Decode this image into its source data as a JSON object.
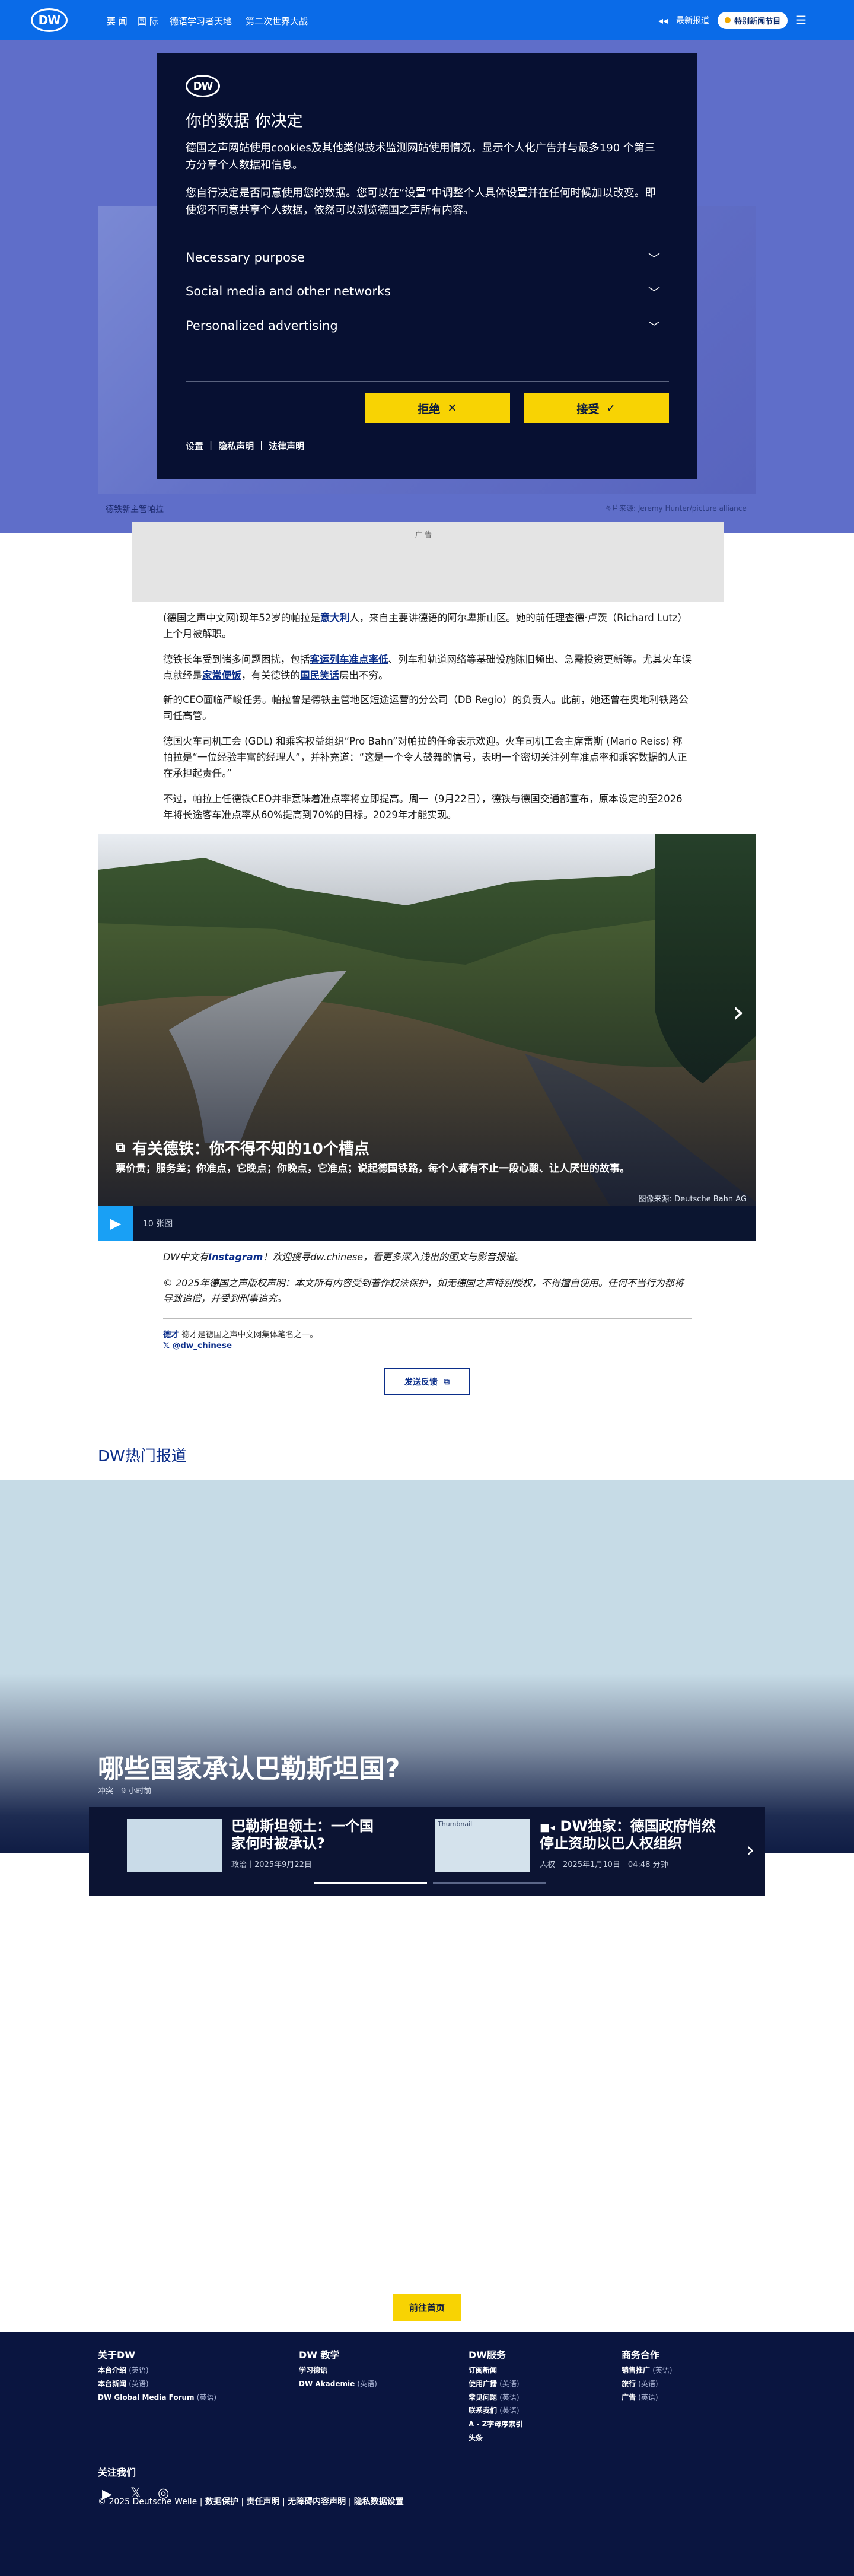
{
  "header": {
    "logo": "DW",
    "nav": [
      "要 闻",
      "国 际",
      "德语学习者天地",
      "第二次世界大战"
    ],
    "live_label": "最新报道",
    "live_pill": "特别新闻节目"
  },
  "hero": {
    "caption_left": "德铁新主管帕拉",
    "caption_right": "图片来源: Jeremy Hunter/picture alliance"
  },
  "ad": {
    "label": "广 告"
  },
  "article": {
    "p1_a": "(德国之声中文网)现年52岁的帕拉是",
    "p1_link": "意大利",
    "p1_b": "人，来自主要讲德语的阿尔卑斯山区。她的前任理查德·卢茨（Richard Lutz）上个月被解职。",
    "p2_a": "德铁长年受到诸多问题困扰，包括",
    "p2_link1": "客运列车准点率低",
    "p2_b": "、列车和轨道网络等基础设施陈旧频出、急需投资更新等。尤其火车误点就经是",
    "p2_link2": "家常便饭",
    "p2_c": "，有关德铁的",
    "p2_link3": "国民笑话",
    "p2_d": "层出不穷。",
    "p3": "新的CEO面临严峻任务。帕拉曾是德铁主管地区短途运营的分公司（DB Regio）的负责人。此前，她还曾在奥地利铁路公司任高管。",
    "p4": "德国火车司机工会 (GDL) 和乘客权益组织“Pro Bahn”对帕拉的任命表示欢迎。火车司机工会主席雷斯 (Mario Reiss) 称帕拉是“一位经验丰富的经理人”，并补充道：“这是一个令人鼓舞的信号，表明一个密切关注列车准点率和乘客数据的人正在承担起责任。”",
    "p5": "不过，帕拉上任德铁CEO并非意味着准点率将立即提高。周一（9月22日），德铁与德国交通部宣布，原本设定的至2026年将长途客车准点率从60%提高到70%的目标。2029年才能实现。"
  },
  "gallery": {
    "title": "有关德铁：你不得不知的10个槽点",
    "subtitle": "票价贵；服务差；你准点，它晚点；你晚点，它准点；说起德国铁路，每个人都有不止一段心酸、让人厌世的故事。",
    "credit": "图像来源: Deutsche Bahn AG",
    "count": "10 张图"
  },
  "footnote": {
    "n1_a": "DW中文有",
    "n1_link": "Instagram",
    "n1_b": "！欢迎搜寻dw.chinese，看更多深入浅出的图文与影音报道。",
    "n2": "© 2025年德国之声版权声明：本文所有内容受到著作权法保护，如无德国之声特别授权，不得擅自使用。任何不当行为都将导致追偿，并受到刑事追究。"
  },
  "author": {
    "name": "德才",
    "text": "德才是德国之声中文网集体笔名之一。",
    "handle": "@dw_chinese"
  },
  "feedback": {
    "label": "发送反馈"
  },
  "hot": {
    "section_title": "DW热门报道",
    "headline": "哪些国家承认巴勒斯坦国?",
    "meta": "冲突｜9 小时前",
    "cards": [
      {
        "title": "巴勒斯坦领土：一个国家何时被承认?",
        "meta": "政治｜2025年9月22日"
      },
      {
        "title": "DW独家：德国政府悄然停止资助以巴人权组织",
        "meta": "人权｜2025年1月10日｜04:48 分钟",
        "img_alt": "Thumbnail"
      }
    ]
  },
  "home_button": {
    "label": "前往首页"
  },
  "footer": {
    "col1": {
      "heading": "关于DW",
      "links": [
        {
          "t": "本台介绍",
          "s": "(英语)"
        },
        {
          "t": "本台新闻",
          "s": "(英语)"
        },
        {
          "t": "DW Global Media Forum",
          "s": "(英语)"
        }
      ]
    },
    "col2": {
      "heading": "DW 教学",
      "links": [
        {
          "t": "学习德语",
          "s": ""
        },
        {
          "t": "DW Akademie",
          "s": "(英语)"
        }
      ]
    },
    "col3": {
      "heading": "DW服务",
      "links": [
        {
          "t": "订阅新闻",
          "s": ""
        },
        {
          "t": "使用广播",
          "s": "(英语)"
        },
        {
          "t": "常见问题",
          "s": "(英语)"
        },
        {
          "t": "联系我们",
          "s": "(英语)"
        },
        {
          "t": "A - Z字母序索引",
          "s": ""
        },
        {
          "t": "头条",
          "s": ""
        }
      ]
    },
    "col4": {
      "heading": "商务合作",
      "links": [
        {
          "t": "销售推广",
          "s": "(英语)"
        },
        {
          "t": "旅行",
          "s": "(英语)"
        },
        {
          "t": "广告",
          "s": "(英语)"
        }
      ]
    },
    "follow_label": "关注我们",
    "copyright": "© 2025 Deutsche Welle",
    "bottom_links": [
      "数据保护",
      "责任声明",
      "无障碍内容声明",
      "隐私数据设置"
    ]
  },
  "cookie": {
    "logo": "DW",
    "title": "你的数据 你决定",
    "p1": "德国之声网站使用cookies及其他类似技术监测网站使用情况，显示个人化广告并与最多190 个第三方分享个人数据和信息。",
    "p2": "您自行决定是否同意使用您的数据。您可以在“设置”中调整个人具体设置并在任何时候加以改变。即使您不同意共享个人数据，依然可以浏览德国之声所有内容。",
    "purposes": [
      "Necessary purpose",
      "Social media and other networks",
      "Personalized advertising"
    ],
    "reject": "拒绝",
    "accept": "接受",
    "links": [
      "设置",
      "隐私声明",
      "法律声明"
    ]
  },
  "colors": {
    "brand_blue": "#0a6be8",
    "navy": "#071032",
    "yellow": "#f8d303",
    "link": "#0b2e8a"
  }
}
